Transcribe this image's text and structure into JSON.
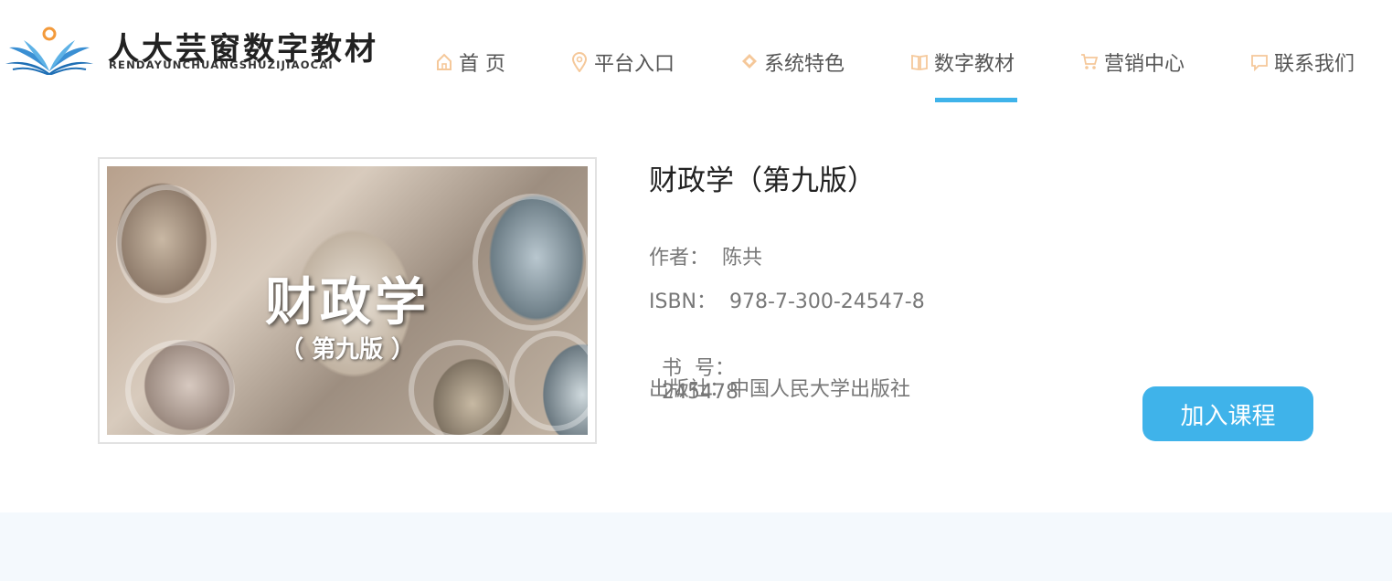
{
  "brand": {
    "name_cn": "人大芸窗数字教材",
    "name_en": "RENDAYUNCHUANGSHUZIJIAOCAI"
  },
  "nav": {
    "items": [
      {
        "label": "首 页",
        "icon": "home-icon"
      },
      {
        "label": "平台入口",
        "icon": "location-pin-icon"
      },
      {
        "label": "系统特色",
        "icon": "diamond-pin-icon"
      },
      {
        "label": "数字教材",
        "icon": "open-book-icon",
        "active": true
      },
      {
        "label": "营销中心",
        "icon": "cart-icon"
      },
      {
        "label": "联系我们",
        "icon": "chat-bubble-icon"
      }
    ],
    "active_color": "#3fb3ea",
    "icon_color": "#f5c89a"
  },
  "book": {
    "title": "财政学（第九版）",
    "cover_title": "财政学",
    "cover_subtitle": "（ 第九版 ）",
    "author_label": "作者：",
    "author": "陈共",
    "isbn_label": "ISBN：",
    "isbn": "978-7-300-24547-8",
    "book_no_label": "书  号：",
    "book_no": "245478",
    "publisher_label": "出版社：",
    "publisher": "中国人民大学出版社"
  },
  "actions": {
    "join_label": "加入课程"
  }
}
